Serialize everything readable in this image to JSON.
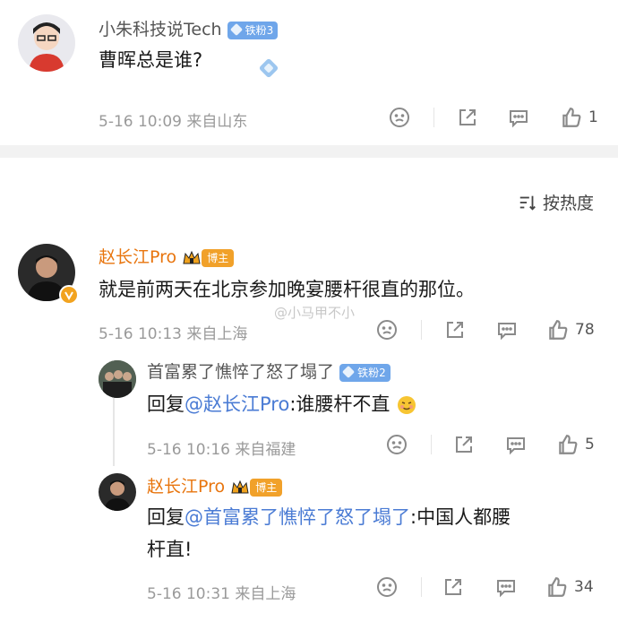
{
  "top_post": {
    "author": "小朱科技说Tech",
    "fan_badge": "铁粉3",
    "text": "曹晖总是谁?",
    "meta": "5-16 10:09  来自山东",
    "like_count": "1"
  },
  "sort": {
    "label": "按热度"
  },
  "comments": [
    {
      "author": "赵长江Pro",
      "host_badge": "博主",
      "text": "就是前两天在北京参加晚宴腰杆很直的那位。",
      "meta": "5-16 10:13  来自上海",
      "like_count": "78",
      "watermark": "@小马甲不小"
    }
  ],
  "replies": [
    {
      "author": "首富累了憔悴了怒了塌了",
      "fan_badge": "铁粉2",
      "reply_prefix": "回复",
      "mention": "@赵长江Pro",
      "text": ":谁腰杆不直",
      "meta": "5-16 10:16  来自福建",
      "like_count": "5"
    },
    {
      "author": "赵长江Pro",
      "host_badge": "博主",
      "reply_prefix": "回复",
      "mention": "@首富累了憔悴了怒了塌了",
      "text_line1": ":中国人都腰",
      "text_line2": "杆直!",
      "meta": "5-16 10:31  来自上海",
      "like_count": "34"
    }
  ],
  "icons": [
    "dislike-icon",
    "share-icon",
    "comment-icon",
    "like-icon",
    "sort-icon",
    "crown-icon",
    "verified-icon"
  ],
  "colors": {
    "orange": "#e8750e",
    "link": "#4a7bd4",
    "fan_badge": "#6fa6ea",
    "host_badge": "#f1a12a"
  }
}
